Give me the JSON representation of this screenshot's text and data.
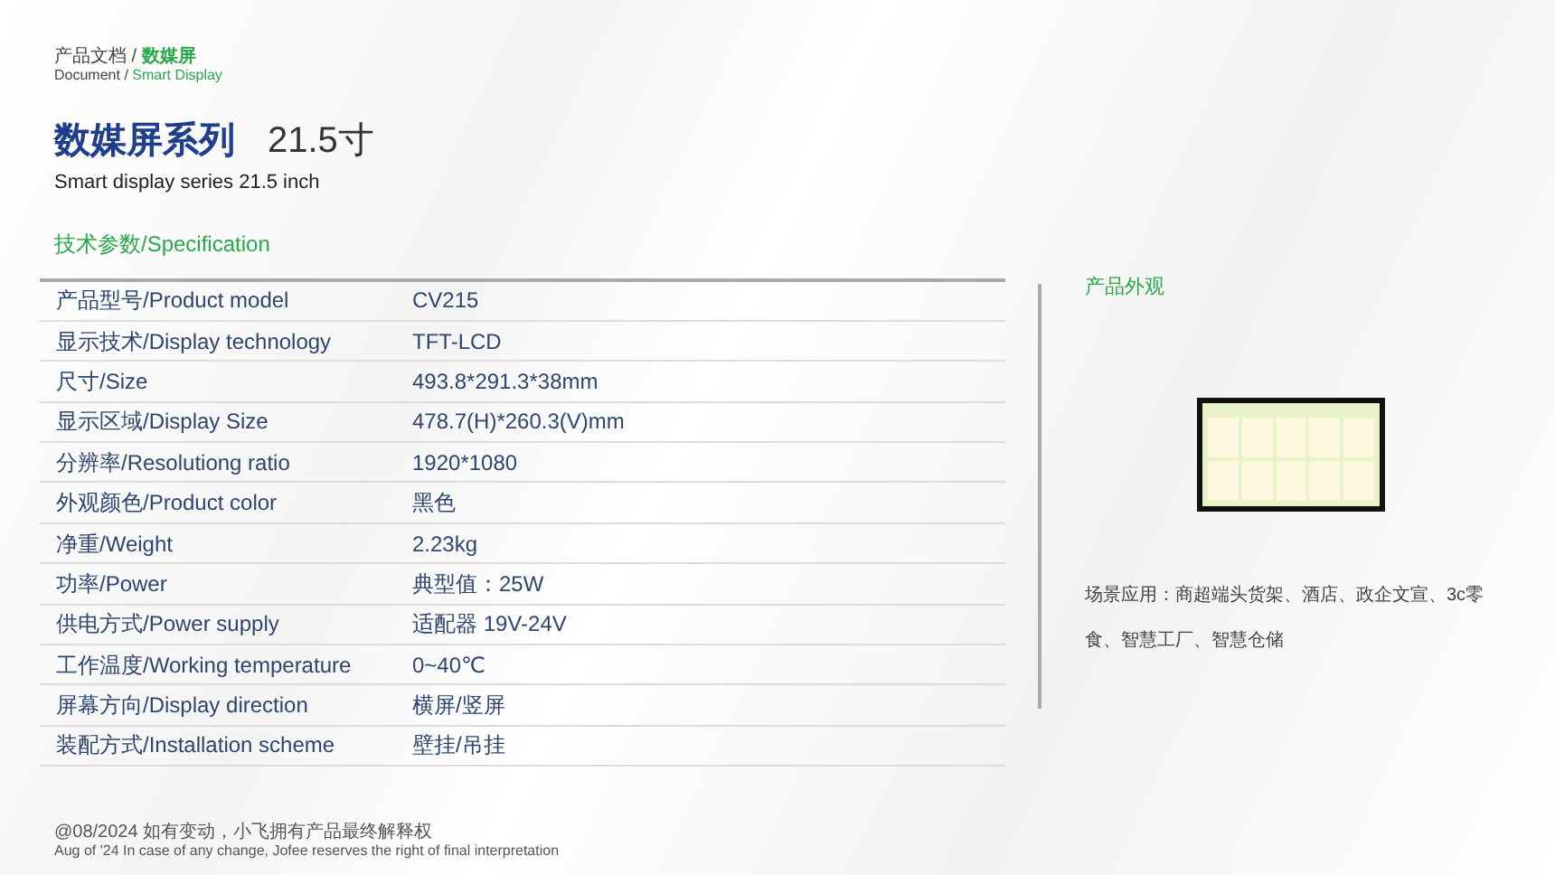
{
  "breadcrumb": {
    "separator": "/",
    "items": [
      {
        "zh": "产品文档",
        "en": "Document",
        "selected": false
      },
      {
        "zh": "数媒屏",
        "en": "Smart Display",
        "selected": true
      }
    ]
  },
  "title": {
    "series": "数媒屏系列",
    "size": "21.5寸",
    "subtitle": "Smart display series 21.5 inch"
  },
  "section_title": "技术参数/Specification",
  "specs": [
    {
      "label": "产品型号/Product model",
      "value": "CV215"
    },
    {
      "label": "显示技术/Display technology",
      "value": "TFT-LCD"
    },
    {
      "label": "尺寸/Size",
      "value": "493.8*291.3*38mm"
    },
    {
      "label": "显示区域/Display Size",
      "value": "478.7(H)*260.3(V)mm"
    },
    {
      "label": "分辨率/Resolutiong ratio",
      "value": "1920*1080"
    },
    {
      "label": "外观颜色/Product color",
      "value": "黑色"
    },
    {
      "label": "净重/Weight",
      "value": "2.23kg"
    },
    {
      "label": "功率/Power",
      "value": "典型值：25W"
    },
    {
      "label": "供电方式/Power supply",
      "value": "适配器 19V-24V"
    },
    {
      "label": "工作温度/Working temperature",
      "value": "0~40℃"
    },
    {
      "label": "屏幕方向/Display direction",
      "value": "横屏/竖屏"
    },
    {
      "label": "装配方式/Installation scheme",
      "value": "壁挂/吊挂"
    }
  ],
  "appearance": {
    "title": "产品外观",
    "scenario": "场景应用：商超端头货架、酒店、政企文宣、3c零食、智慧工厂、智慧仓储"
  },
  "footer": {
    "notice": "@08/2024  如有变动，小飞拥有产品最终解释权",
    "notice_en": "Aug of '24 In case of any change, Jofee reserves the right of final interpretation"
  }
}
